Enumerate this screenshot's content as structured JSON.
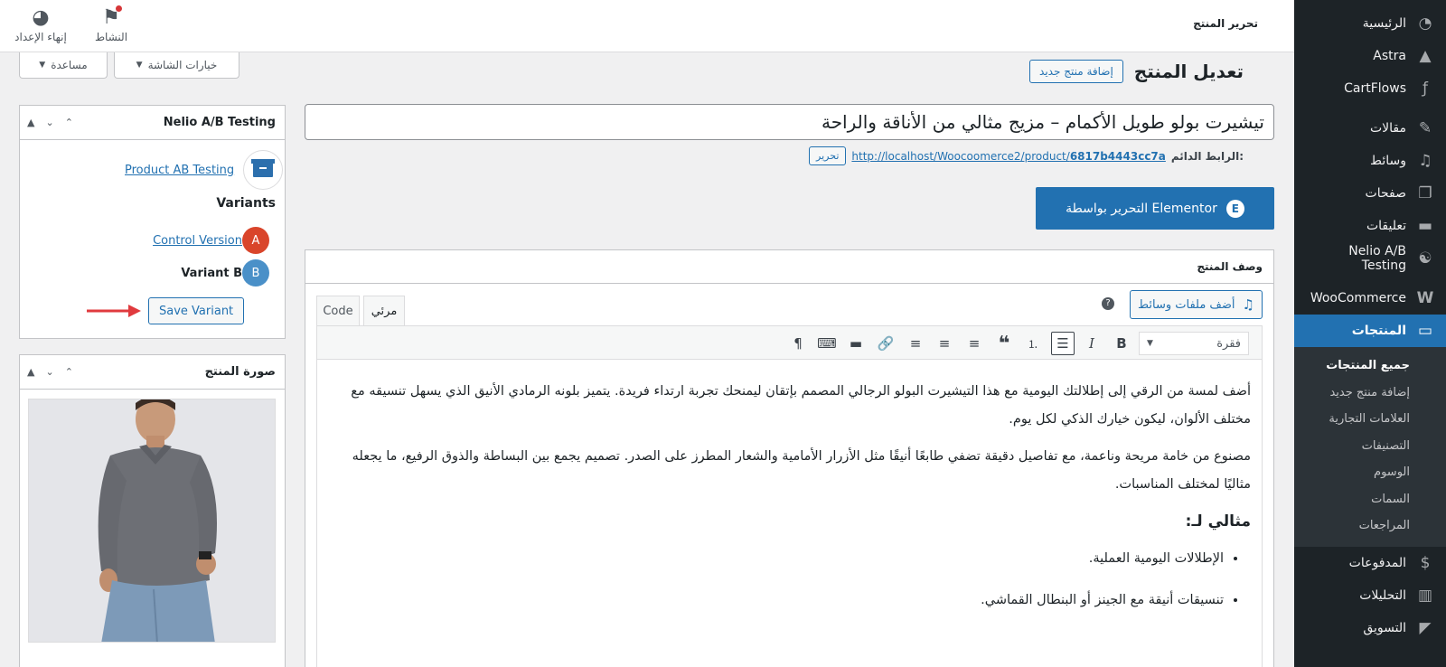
{
  "sidebar": {
    "items_top": [
      {
        "label": "الرئيسية",
        "icon": "dashboard-icon",
        "glyph": "◔"
      },
      {
        "label": "Astra",
        "icon": "astra-icon",
        "glyph": "▲"
      },
      {
        "label": "CartFlows",
        "icon": "cartflows-icon",
        "glyph": "ƒ"
      }
    ],
    "items_mid": [
      {
        "label": "مقالات",
        "icon": "pin-icon",
        "glyph": "✎"
      },
      {
        "label": "وسائط",
        "icon": "media-icon",
        "glyph": "♫"
      },
      {
        "label": "صفحات",
        "icon": "pages-icon",
        "glyph": "❐"
      },
      {
        "label": "تعليقات",
        "icon": "comments-icon",
        "glyph": "▬"
      },
      {
        "label": "Nelio A/B Testing",
        "icon": "nelio-icon",
        "glyph": "☯"
      }
    ],
    "woocommerce": {
      "label": "WooCommerce",
      "icon": "woocommerce-icon",
      "glyph": "W"
    },
    "products": {
      "label": "المنتجات",
      "icon": "products-icon",
      "glyph": "▭"
    },
    "products_sub": [
      "جميع المنتجات",
      "إضافة منتج جديد",
      "العلامات التجارية",
      "التصنيفات",
      "الوسوم",
      "السمات",
      "المراجعات"
    ],
    "items_bottom": [
      {
        "label": "المدفوعات",
        "icon": "payments-icon",
        "glyph": "$"
      },
      {
        "label": "التحليلات",
        "icon": "analytics-icon",
        "glyph": "▥"
      },
      {
        "label": "التسويق",
        "icon": "marketing-icon",
        "glyph": "◤"
      }
    ]
  },
  "topbar": {
    "page_heading": "تحرير المنتج",
    "activity_label": "النشاط",
    "finish_setup_label": "إنهاء الإعداد"
  },
  "screen_options": {
    "help_label": "مساعدة",
    "options_label": "خيارات الشاشة"
  },
  "header": {
    "title": "تعديل المنتج",
    "add_new_label": "إضافة منتج جديد"
  },
  "product": {
    "title": "تيشيرت بولو طويل الأكمام – مزيج مثالي من الأناقة والراحة",
    "permalink_label": "الرابط الدائم:",
    "permalink_base": "http://localhost/Woocoomerce2/product/",
    "permalink_slug": "6817b4443cc7a",
    "permalink_edit": "تحرير"
  },
  "elementor": {
    "label": "التحرير بواسطة Elementor"
  },
  "description_box": {
    "title": "وصف المنتج",
    "add_media_label": "أضف ملفات وسائط",
    "tab_visual": "مرئي",
    "tab_code": "Code",
    "format_select": "فقرة",
    "paragraph1": "أضف لمسة من الرقي إلى إطلالتك اليومية مع هذا التيشيرت البولو الرجالي المصمم بإتقان ليمنحك تجربة ارتداء فريدة. يتميز بلونه الرمادي الأنيق الذي يسهل تنسيقه مع مختلف الألوان، ليكون خيارك الذكي لكل يوم.",
    "paragraph2": "مصنوع من خامة مريحة وناعمة، مع تفاصيل دقيقة تضفي طابعًا أنيقًا مثل الأزرار الأمامية والشعار المطرز على الصدر. تصميم يجمع بين البساطة والذوق الرفيع، ما يجعله مثاليًا لمختلف المناسبات.",
    "heading": "مثالي لـ:",
    "bullets": [
      "الإطلالات اليومية العملية.",
      "تنسيقات أنيقة مع الجينز أو البنطال القماشي."
    ]
  },
  "nelio_box": {
    "title": "Nelio A/B Testing",
    "test_link": "Product AB Testing",
    "variants_title": "Variants",
    "control_label": "Control Version",
    "control_badge": "A",
    "variant_label": "Variant B",
    "variant_badge": "B",
    "save_label": "Save Variant",
    "badge_a_color": "#d9452b",
    "badge_b_color": "#4a90c8",
    "arrow_color": "#e03a3e"
  },
  "image_box": {
    "title": "صورة المنتج"
  },
  "colors": {
    "accent": "#2271b1",
    "sidebar_bg": "#1d2327"
  }
}
